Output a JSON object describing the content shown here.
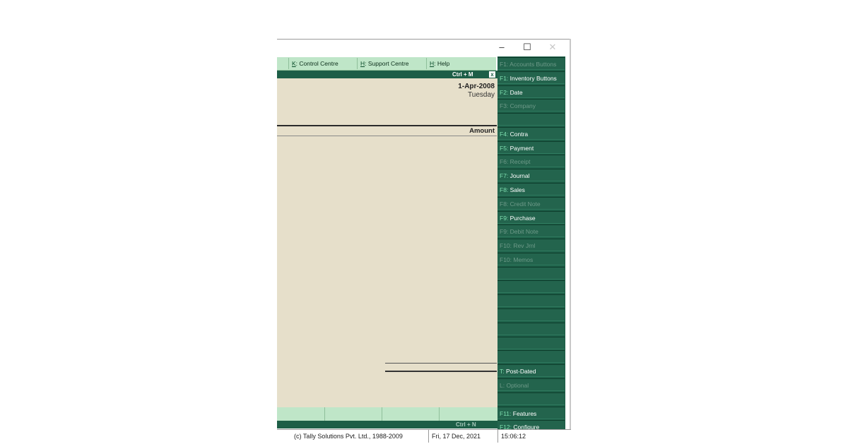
{
  "menu": {
    "control_centre_key": "K",
    "control_centre": ": Control Centre",
    "support_centre_key": "H",
    "support_centre": ": Support Centre",
    "help_key": "H",
    "help": ": Help"
  },
  "shortcuts": {
    "top": "Ctrl + M",
    "top_close": "x",
    "bottom": "Ctrl + N"
  },
  "window_controls": {
    "minimize": "–",
    "maximize": "☐",
    "close": "✕"
  },
  "main": {
    "date": "1-Apr-2008",
    "day": "Tuesday",
    "amount_header": "Amount"
  },
  "side_buttons": [
    {
      "key": "F1:",
      "label": " Accounts Buttons",
      "enabled": false
    },
    {
      "key": "F1:",
      "label": " Inventory Buttons",
      "enabled": true
    },
    {
      "key": "F2:",
      "label": " Date",
      "enabled": true
    },
    {
      "key": "F3:",
      "label": " Company",
      "enabled": false
    },
    {
      "key": "",
      "label": "",
      "enabled": false
    },
    {
      "key": "F4:",
      "label": " Contra",
      "enabled": true
    },
    {
      "key": "F5:",
      "label": " Payment",
      "enabled": true
    },
    {
      "key": "F6:",
      "label": " Receipt",
      "enabled": false
    },
    {
      "key": "F7:",
      "label": " Journal",
      "enabled": true
    },
    {
      "key": "F8:",
      "label": " Sales",
      "enabled": true
    },
    {
      "key": "F8:",
      "label": " Credit Note",
      "enabled": false
    },
    {
      "key": "F9:",
      "label": " Purchase",
      "enabled": true
    },
    {
      "key": "F9:",
      "label": " Debit Note",
      "enabled": false
    },
    {
      "key": "F10:",
      "label": " Rev Jrnl",
      "enabled": false
    },
    {
      "key": "F10:",
      "label": " Memos",
      "enabled": false
    },
    {
      "key": "",
      "label": "",
      "enabled": false
    },
    {
      "key": "",
      "label": "",
      "enabled": false
    },
    {
      "key": "",
      "label": "",
      "enabled": false
    },
    {
      "key": "",
      "label": "",
      "enabled": false
    },
    {
      "key": "",
      "label": "",
      "enabled": false
    },
    {
      "key": "",
      "label": "",
      "enabled": false
    },
    {
      "key": "",
      "label": "",
      "enabled": false
    },
    {
      "key": "T:",
      "label": " Post-Dated",
      "enabled": true
    },
    {
      "key": "L:",
      "label": " Optional",
      "enabled": false
    },
    {
      "key": "",
      "label": "",
      "enabled": false
    },
    {
      "key": "F11:",
      "label": " Features",
      "enabled": true
    },
    {
      "key": "F12:",
      "label": " Configure",
      "enabled": true
    }
  ],
  "status": {
    "copyright": "(c) Tally Solutions Pvt. Ltd., 1988-2009",
    "date": "Fri, 17 Dec, 2021",
    "time": "15:06:12"
  },
  "colors": {
    "panel_bg": "#e6dfca",
    "menu_bg": "#bfe6c8",
    "sidebar_bg": "#1d5e47",
    "key_accent": "#7ee0b0"
  }
}
